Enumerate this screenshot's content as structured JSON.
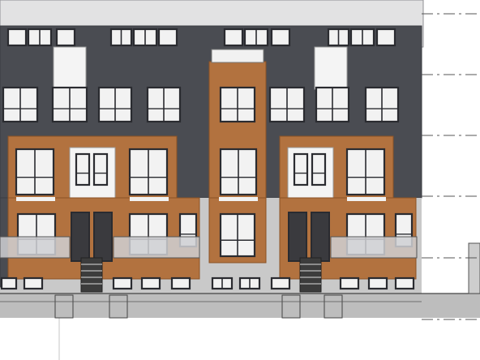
{
  "drawing": {
    "subject": "townhouse-block-front-elevation",
    "colors": {
      "background": "#ffffff",
      "paper_edge": "#e9e9ea",
      "dark_cladding": "#4a4c52",
      "dark_cladding_edge": "#3a3c41",
      "brick": "#b2723f",
      "brick_edge": "#8a5226",
      "white_panel": "#f4f4f4",
      "stone_base": "#c9c9c9",
      "window_frame": "#2a2b30",
      "window_glass": "#f2f2f2",
      "balcony_glass": "#c7c8cb",
      "ground": "#bdbdbd",
      "dash_line": "#555555",
      "guide_line": "#d7d7d7"
    }
  }
}
